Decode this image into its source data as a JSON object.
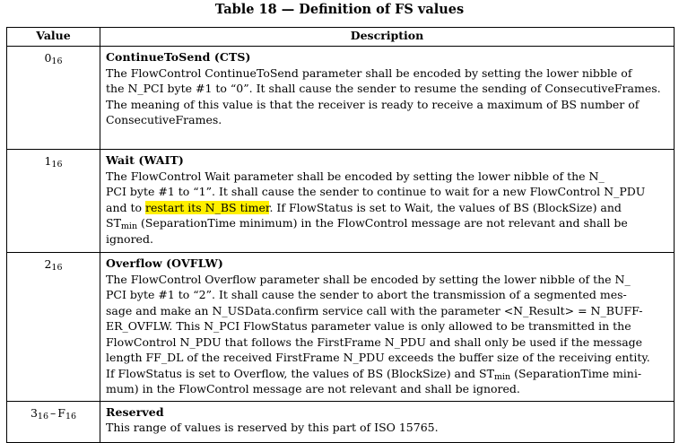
{
  "title": "Table 18 — Definition of FS values",
  "headers": {
    "value": "Value",
    "description": "Description"
  },
  "rows": [
    {
      "value_base": "0",
      "value_sub": "16",
      "name": "ContinueToSend (CTS)",
      "lines": [
        "The FlowControl ContinueToSend parameter shall be encoded by setting the lower nibble of",
        "the N_PCI byte #1 to “0”. It shall cause the sender to resume the sending of ConsecutiveFrames.",
        "The meaning of this value is that the receiver is ready to receive a maximum of BS number of",
        "ConsecutiveFrames."
      ]
    },
    {
      "value_base": "1",
      "value_sub": "16",
      "name": "Wait (WAIT)",
      "lines": [
        "The FlowControl Wait parameter shall be encoded by setting the lower nibble of the N_",
        "PCI byte #1 to “1”. It shall cause the sender to continue to wait for a new FlowControl N_PDU"
      ],
      "line3_pre": "and to ",
      "line3_highlight": "restart its N_BS timer",
      "line3_post": ". If FlowStatus is set to Wait, the values of BS (BlockSize) and",
      "line4_pre": "ST",
      "line4_sub": "min",
      "line4_post": " (SeparationTime minimum) in the FlowControl message are not relevant and shall be",
      "line5": "ignored."
    },
    {
      "value_base": "2",
      "value_sub": "16",
      "name": "Overflow (OVFLW)",
      "lines": [
        "The FlowControl Overflow parameter shall be encoded by setting the lower nibble of the N_",
        "PCI byte #1 to “2”. It shall cause the sender to abort the transmission of a segmented mes-",
        "sage and make an N_USData.confirm service call with the parameter <N_Result> = N_BUFF-",
        "ER_OVFLW. This N_PCI FlowStatus parameter value is only allowed to be transmitted in the",
        "FlowControl N_PDU that follows the FirstFrame N_PDU and shall only be used if the message",
        "length FF_DL of the received FirstFrame N_PDU exceeds the buffer size of the receiving entity."
      ],
      "line7_pre": "If FlowStatus is set to Overflow, the values of BS (BlockSize) and ST",
      "line7_sub": "min",
      "line7_post": " (SeparationTime mini-",
      "line8": "mum) in the FlowControl message are not relevant and shall be ignored."
    },
    {
      "value_a": "3",
      "value_a_sub": "16",
      "value_dash": "–",
      "value_b": "F",
      "value_b_sub": "16",
      "name": "Reserved",
      "lines": [
        "This range of values is reserved by this part of ISO 15765."
      ]
    }
  ]
}
